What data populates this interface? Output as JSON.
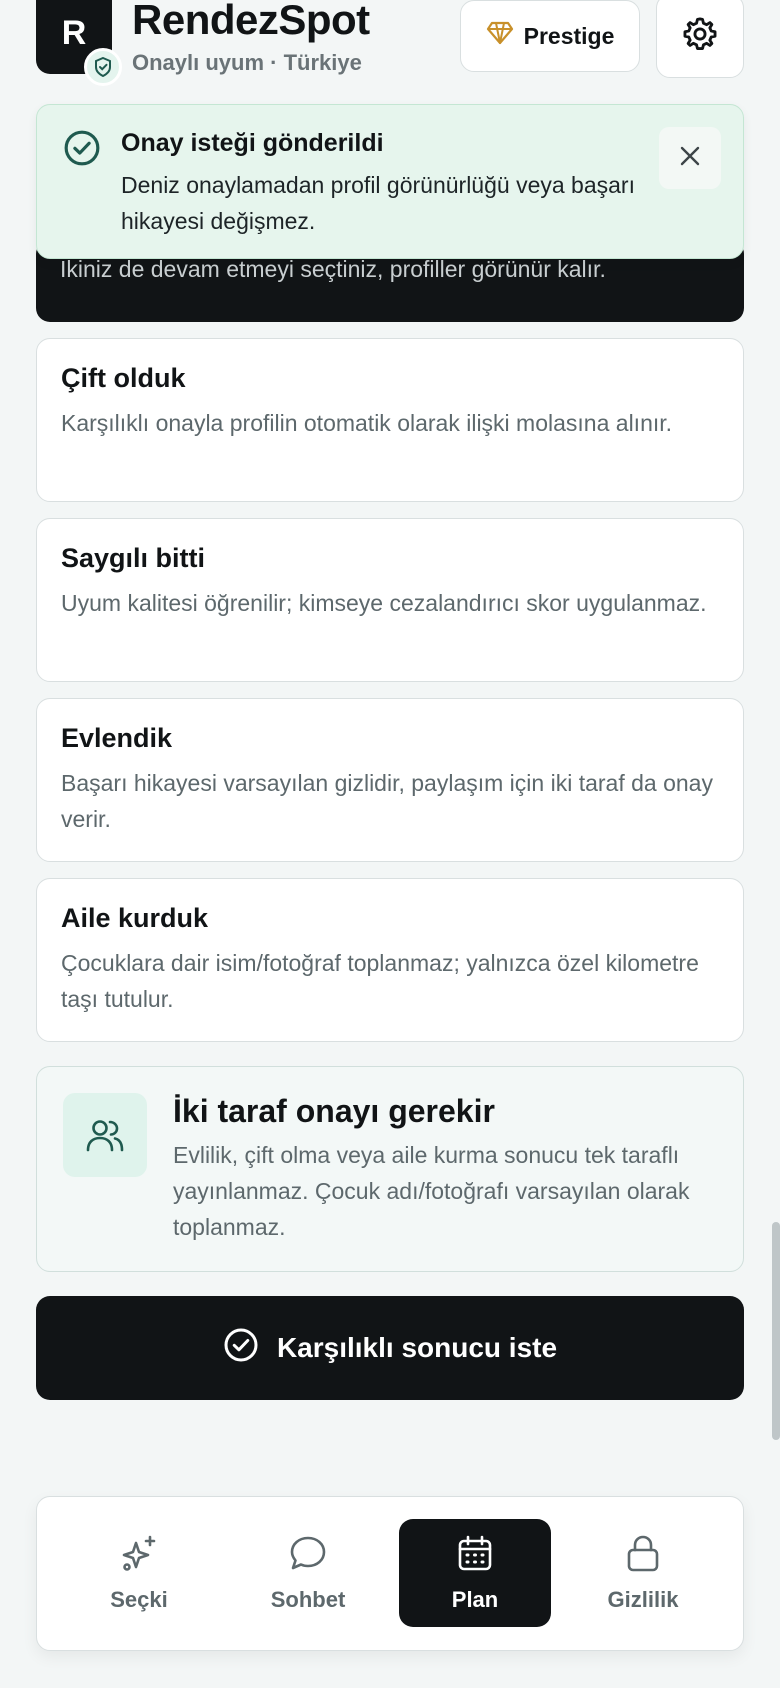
{
  "header": {
    "logo_letter": "R",
    "app_title": "RendezSpot",
    "subtitle": "Onaylı uyum · Türkiye",
    "prestige_label": "Prestige",
    "settings_icon": "gear-icon"
  },
  "hidden_card": {
    "text": "İkiniz de devam etmeyi seçtiniz, profiller görünür kalır."
  },
  "toast": {
    "title": "Onay isteği gönderildi",
    "body": "Deniz onaylamadan profil görünürlüğü veya başarı hikayesi değişmez."
  },
  "options": [
    {
      "title": "Çift olduk",
      "desc": "Karşılıklı onayla profilin otomatik olarak ilişki molasına alınır."
    },
    {
      "title": "Saygılı bitti",
      "desc": "Uyum kalitesi öğrenilir; kimseye cezalandırıcı skor uygulanmaz."
    },
    {
      "title": "Evlendik",
      "desc": "Başarı hikayesi varsayılan gizlidir, paylaşım için iki taraf da onay verir."
    },
    {
      "title": "Aile kurduk",
      "desc": "Çocuklara dair isim/fotoğraf toplanmaz; yalnızca özel kilometre taşı tutulur."
    }
  ],
  "consent": {
    "title": "İki taraf onayı gerekir",
    "body": "Evlilik, çift olma veya aile kurma sonucu tek taraflı yayınlanmaz. Çocuk adı/fotoğrafı varsayılan olarak toplanmaz."
  },
  "cta": {
    "label": "Karşılıklı sonucu iste"
  },
  "nav": {
    "items": [
      {
        "label": "Seçki",
        "icon": "sparkle-icon"
      },
      {
        "label": "Sohbet",
        "icon": "chat-bubble-icon"
      },
      {
        "label": "Plan",
        "icon": "calendar-icon",
        "active": true
      },
      {
        "label": "Gizlilik",
        "icon": "lock-icon"
      }
    ]
  },
  "colors": {
    "accent_dark": "#111416",
    "success_bg": "#e6f5ed",
    "teal_icon": "#1f5a4f",
    "gold": "#c8902a"
  }
}
